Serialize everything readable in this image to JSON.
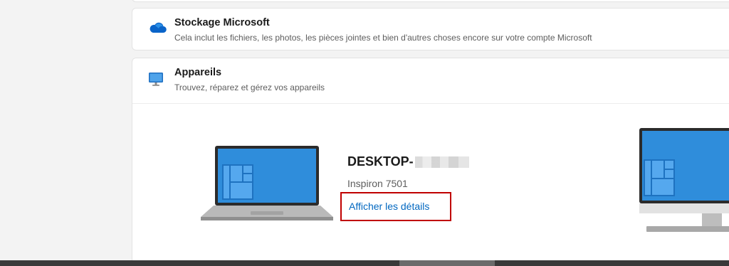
{
  "storage": {
    "icon": "cloud-icon",
    "title": "Stockage Microsoft",
    "subtitle": "Cela inclut les fichiers, les photos, les pièces jointes et bien d'autres choses encore sur votre compte Microsoft"
  },
  "devices": {
    "icon": "monitor-icon",
    "title": "Appareils",
    "subtitle": "Trouvez, réparez et gérez vos appareils",
    "device1": {
      "name_prefix": "DESKTOP-",
      "model": "Inspiron 7501",
      "details_link": "Afficher les détails",
      "image_icon": "laptop-icon"
    },
    "device2": {
      "image_icon": "desktop-computer-icon"
    }
  },
  "colors": {
    "accent": "#0067c0",
    "highlight_box": "#c00000",
    "screen_blue": "#2f8ddb"
  }
}
